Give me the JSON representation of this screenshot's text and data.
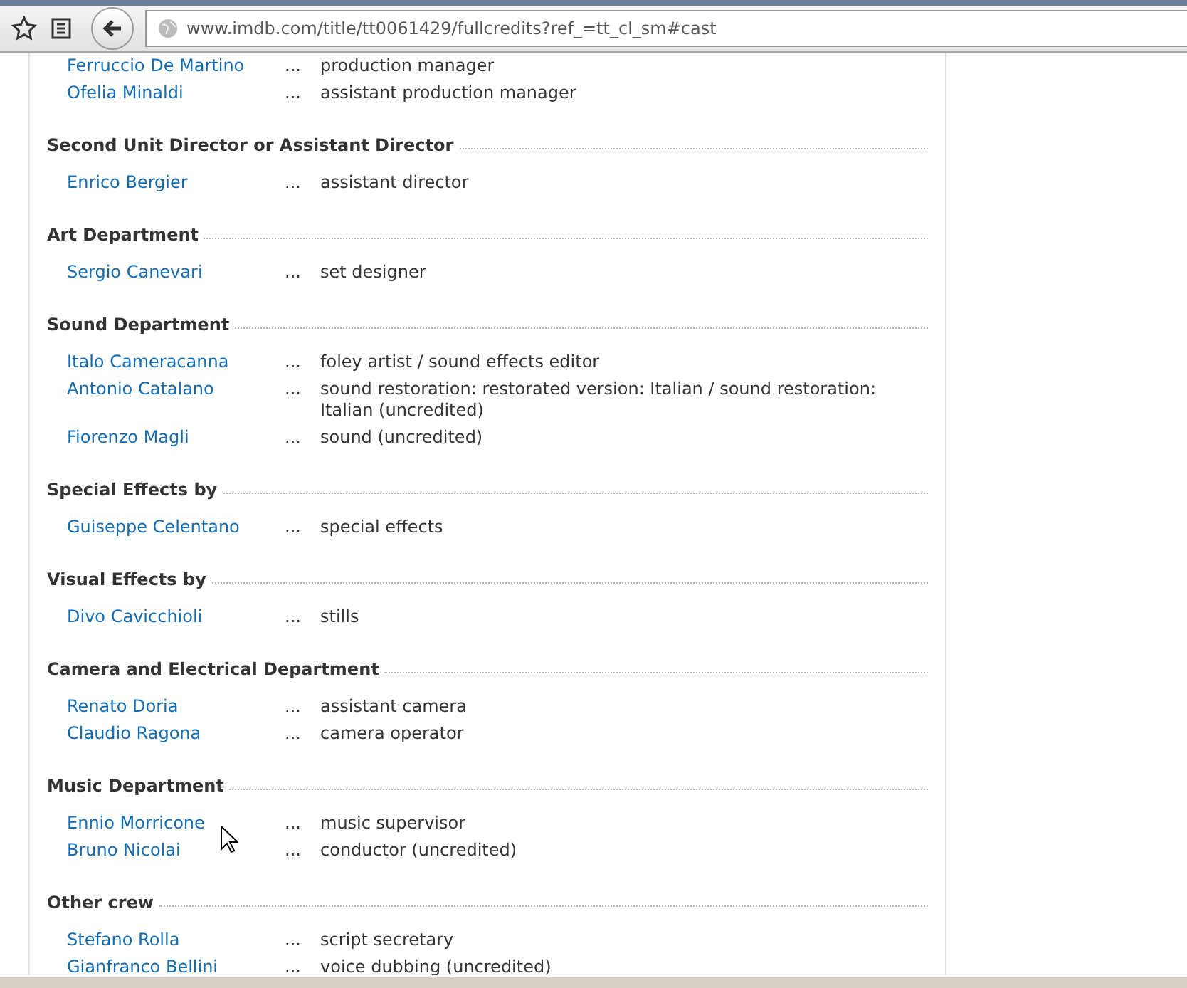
{
  "browser": {
    "url": "www.imdb.com/title/tt0061429/fullcredits?ref_=tt_cl_sm#cast"
  },
  "sections": [
    {
      "credits": [
        {
          "name": "Ferruccio De Martino",
          "role": "production manager"
        },
        {
          "name": "Ofelia Minaldi",
          "role": "assistant production manager"
        }
      ]
    },
    {
      "title": "Second Unit Director or Assistant Director",
      "credits": [
        {
          "name": "Enrico Bergier",
          "role": "assistant director"
        }
      ]
    },
    {
      "title": "Art Department",
      "credits": [
        {
          "name": "Sergio Canevari",
          "role": "set designer"
        }
      ]
    },
    {
      "title": "Sound Department",
      "credits": [
        {
          "name": "Italo Cameracanna",
          "role": "foley artist / sound effects editor"
        },
        {
          "name": "Antonio Catalano",
          "role": "sound restoration: restorated version: Italian / sound restoration: Italian (uncredited)"
        },
        {
          "name": "Fiorenzo Magli",
          "role": "sound (uncredited)"
        }
      ]
    },
    {
      "title": "Special Effects by",
      "credits": [
        {
          "name": "Guiseppe Celentano",
          "role": "special effects"
        }
      ]
    },
    {
      "title": "Visual Effects by",
      "credits": [
        {
          "name": "Divo Cavicchioli",
          "role": "stills"
        }
      ]
    },
    {
      "title": "Camera and Electrical Department",
      "credits": [
        {
          "name": "Renato Doria",
          "role": "assistant camera"
        },
        {
          "name": "Claudio Ragona",
          "role": "camera operator"
        }
      ]
    },
    {
      "title": "Music Department",
      "credits": [
        {
          "name": "Ennio Morricone",
          "role": "music supervisor"
        },
        {
          "name": "Bruno Nicolai",
          "role": "conductor (uncredited)"
        }
      ]
    },
    {
      "title": "Other crew",
      "credits": [
        {
          "name": "Stefano Rolla",
          "role": "script secretary"
        },
        {
          "name": "Gianfranco Bellini",
          "role": "voice dubbing (uncredited)"
        }
      ]
    }
  ],
  "separator": "..."
}
